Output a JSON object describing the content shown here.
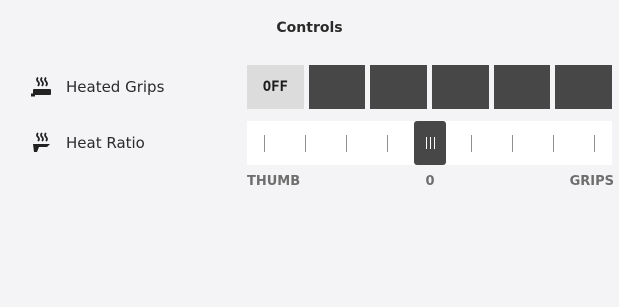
{
  "title": "Controls",
  "heated_grips": {
    "label": "Heated Grips",
    "icon": "heated-grip-icon",
    "off_label": "OFF",
    "levels": 5
  },
  "heat_ratio": {
    "label": "Heat Ratio",
    "icon": "heat-ratio-icon",
    "left_label": "THUMB",
    "center_label": "0",
    "right_label": "GRIPS",
    "value": 0
  },
  "colors": {
    "active_segment": "#474747",
    "off_segment": "#dcdcdc",
    "background": "#f4f4f6"
  }
}
